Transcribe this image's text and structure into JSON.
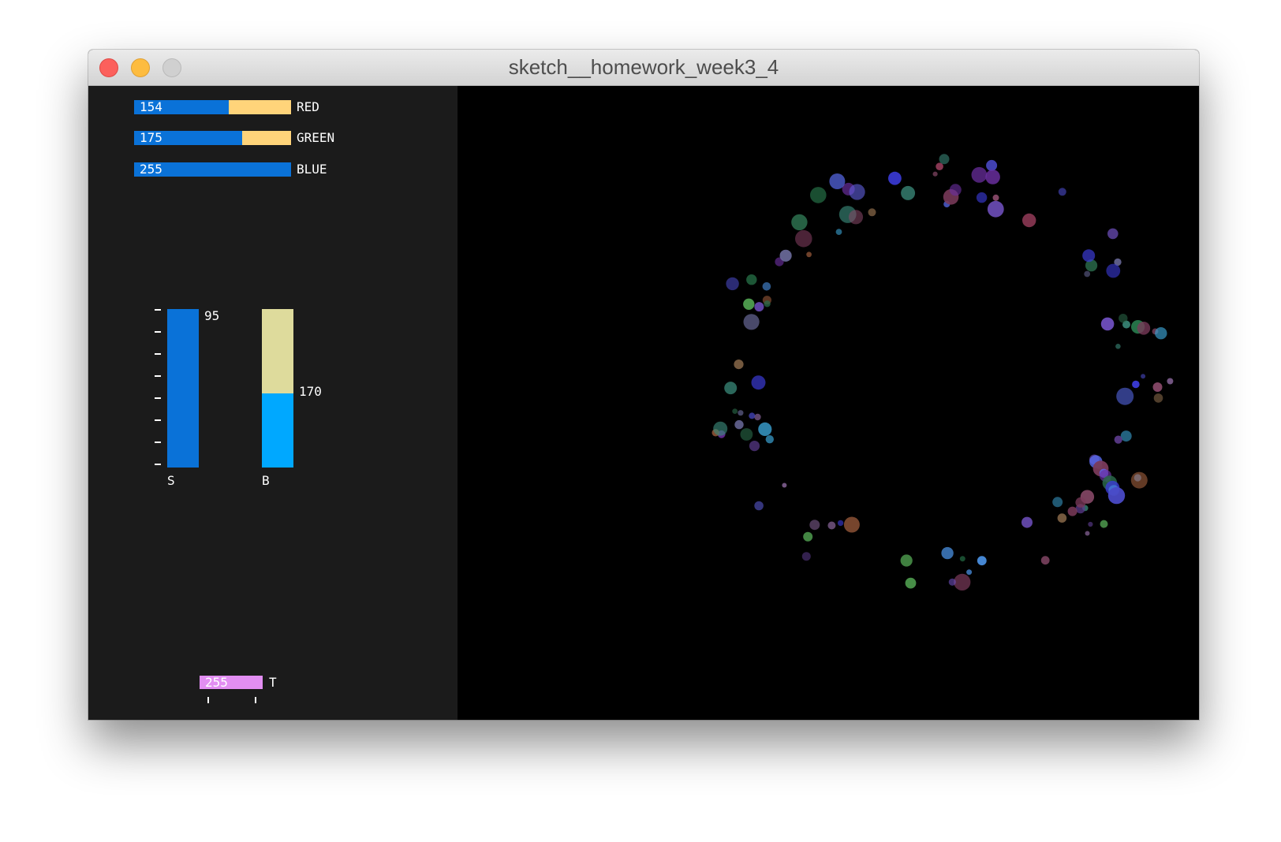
{
  "window": {
    "title": "sketch__homework_week3_4"
  },
  "controls": {
    "red": {
      "label": "RED",
      "value": "154",
      "fraction": 0.604
    },
    "green": {
      "label": "GREEN",
      "value": "175",
      "fraction": 0.686
    },
    "blue": {
      "label": "BLUE",
      "value": "255",
      "fraction": 1.0
    },
    "saturation": {
      "label": "S",
      "value": "95",
      "fraction": 1.0
    },
    "brightness": {
      "label": "B",
      "value": "170",
      "fraction": 0.47
    },
    "transparency": {
      "label": "T",
      "value": "255"
    }
  },
  "colors": {
    "panel_bg": "#1b1b1b",
    "canvas_bg": "#000000",
    "slider_fill": "#0a72d8",
    "slider_track": "#ffd47a",
    "brightness_fill": "#00a8ff",
    "brightness_track": "#dedb9c",
    "transparency_fill": "#e28ef2"
  }
}
